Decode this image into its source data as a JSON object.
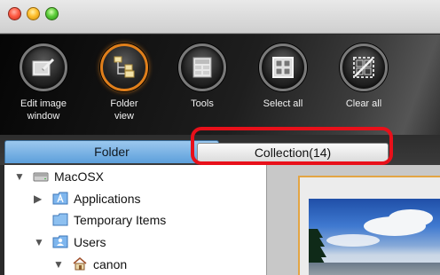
{
  "window": {
    "traffic_lights": [
      "close",
      "minimize",
      "zoom"
    ]
  },
  "toolbar": {
    "tools": [
      {
        "label": "Edit image\nwindow",
        "icon": "edit-image-window-icon"
      },
      {
        "label": "Folder\nview",
        "icon": "folder-view-icon"
      },
      {
        "label": "Tools",
        "icon": "tools-icon"
      },
      {
        "label": "Select all",
        "icon": "select-all-icon"
      },
      {
        "label": "Clear all",
        "icon": "clear-all-icon"
      }
    ]
  },
  "tabs": {
    "folder": "Folder",
    "collection": "Collection(14)"
  },
  "colors": {
    "highlight": "#e8101a",
    "active_tool_ring": "#e07f1b",
    "folder_tab": "#5c9fdb"
  },
  "tree": [
    {
      "label": "MacOSX",
      "expanded": true,
      "icon": "hard-drive-icon"
    },
    {
      "label": "Applications",
      "expanded": false,
      "icon": "applications-folder-icon"
    },
    {
      "label": "Temporary Items",
      "icon": "folder-icon"
    },
    {
      "label": "Users",
      "expanded": true,
      "icon": "users-folder-icon"
    },
    {
      "label": "canon",
      "expanded": true,
      "icon": "home-folder-icon"
    }
  ]
}
